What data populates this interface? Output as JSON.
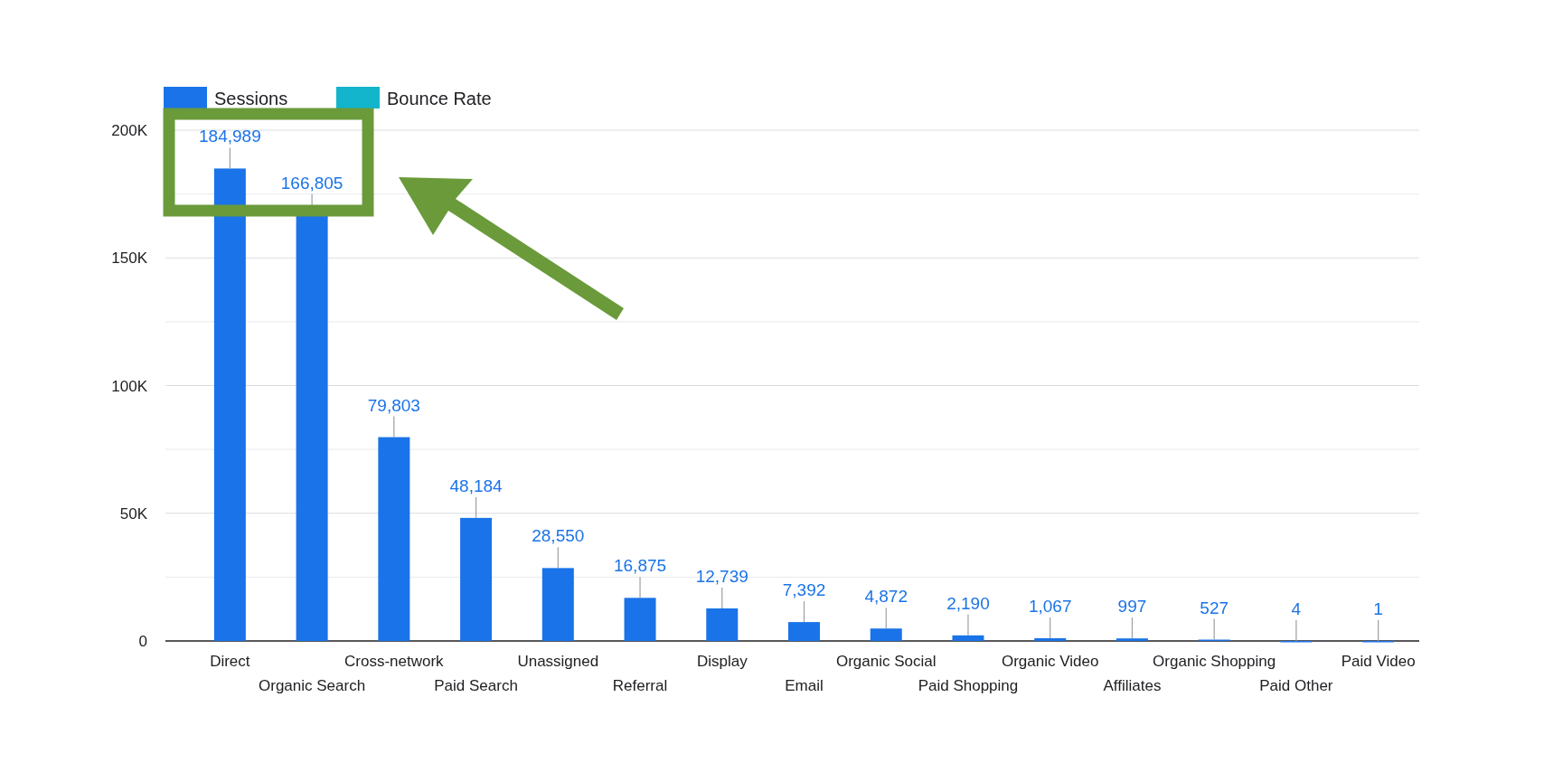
{
  "chart_data": {
    "type": "bar",
    "categories": [
      "Direct",
      "Organic Search",
      "Cross-network",
      "Paid Search",
      "Unassigned",
      "Referral",
      "Display",
      "Email",
      "Organic Social",
      "Paid Shopping",
      "Organic Video",
      "Affiliates",
      "Organic Shopping",
      "Paid Other",
      "Paid Video"
    ],
    "series": [
      {
        "name": "Sessions",
        "color": "#1a73e8",
        "values": [
          184989,
          166805,
          79803,
          48184,
          28550,
          16875,
          12739,
          7392,
          4872,
          2190,
          1067,
          997,
          527,
          4,
          1
        ]
      },
      {
        "name": "Bounce Rate",
        "color": "#12b5cb",
        "values": [
          null,
          null,
          null,
          null,
          null,
          null,
          null,
          null,
          null,
          null,
          null,
          null,
          null,
          null,
          null
        ]
      }
    ],
    "ylim": [
      0,
      200000
    ],
    "grid": true,
    "yticks": [
      {
        "value": 0,
        "label": "0"
      },
      {
        "value": 50000,
        "label": "50K"
      },
      {
        "value": 100000,
        "label": "100K"
      },
      {
        "value": 150000,
        "label": "150K"
      },
      {
        "value": 200000,
        "label": "200K"
      }
    ],
    "value_labels": [
      "184,989",
      "166,805",
      "79,803",
      "48,184",
      "28,550",
      "16,875",
      "12,739",
      "7,392",
      "4,872",
      "2,190",
      "1,067",
      "997",
      "527",
      "4",
      "1"
    ]
  }
}
